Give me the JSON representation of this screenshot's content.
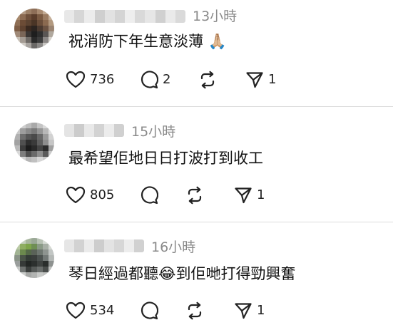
{
  "comments": [
    {
      "time": "13小時",
      "text": "祝消防下年生意淡薄 🙏🏼",
      "likes": "736",
      "replies": "2",
      "reposts": "",
      "shares": "1"
    },
    {
      "time": "15小時",
      "text": "最希望佢地日日打波打到收工",
      "likes": "805",
      "replies": "",
      "reposts": "",
      "shares": "1"
    },
    {
      "time": "16小時",
      "text": "琴日經過都聽😂到佢哋打得勁興奮",
      "likes": "534",
      "replies": "",
      "reposts": "",
      "shares": "1"
    }
  ],
  "icons": {
    "like": "heart-icon",
    "reply": "speech-bubble-icon",
    "repost": "repost-icon",
    "share": "send-icon"
  },
  "colors": {
    "text": "#111111",
    "muted": "#8a8a8a",
    "divider": "#dcdcdc"
  }
}
